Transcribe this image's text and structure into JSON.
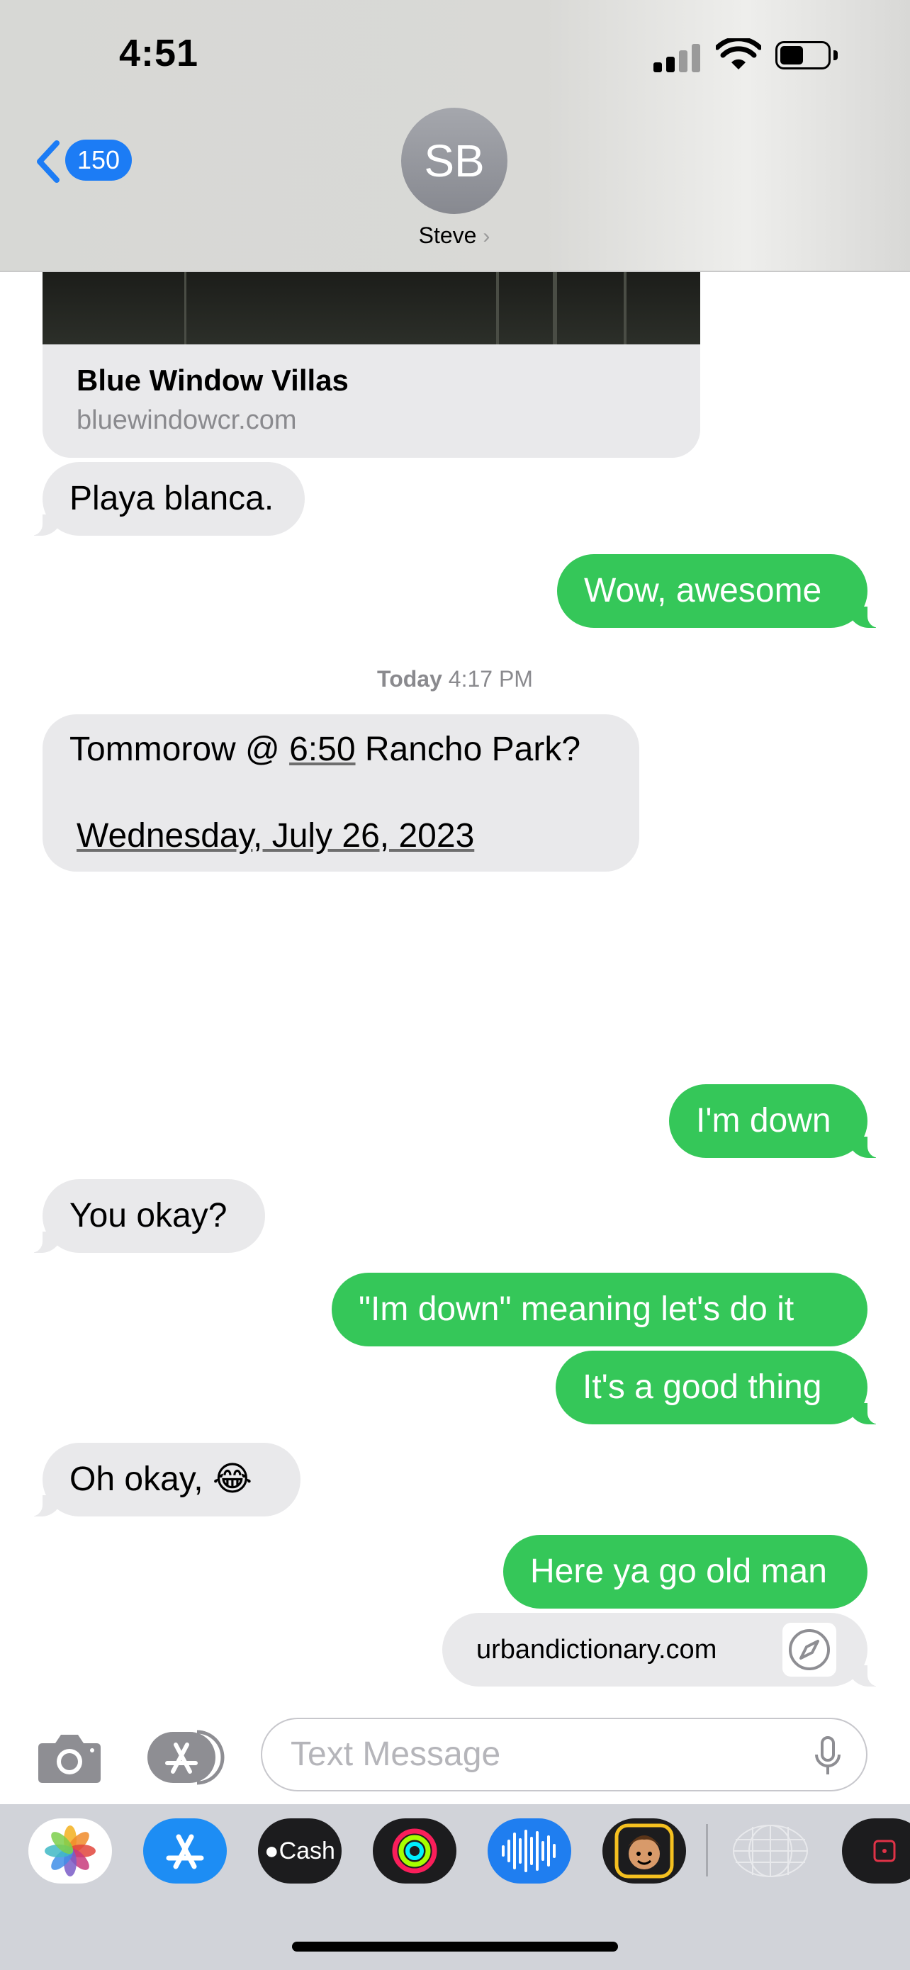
{
  "status_bar": {
    "time": "4:51"
  },
  "header": {
    "back_count": "150",
    "avatar_initials": "SB",
    "contact_name": "Steve"
  },
  "link_card": {
    "title": "Blue Window Villas",
    "domain": "bluewindowcr.com"
  },
  "messages": [
    {
      "id": "m1",
      "direction": "in",
      "text": "Playa blanca."
    },
    {
      "id": "m2",
      "direction": "out",
      "text": "Wow, awesome"
    },
    {
      "id": "m4",
      "direction": "out",
      "text": "I'm down"
    },
    {
      "id": "m5",
      "direction": "in",
      "text": "You okay?"
    },
    {
      "id": "m6",
      "direction": "out",
      "text": "\"Im down\" meaning let's do it"
    },
    {
      "id": "m7",
      "direction": "out",
      "text": "It's a good thing"
    },
    {
      "id": "m8",
      "direction": "in",
      "text": "Oh okay, 😂"
    },
    {
      "id": "m9",
      "direction": "out",
      "text": "Here ya go old man"
    }
  ],
  "timestamp": {
    "day": "Today",
    "time": "4:17 PM"
  },
  "big_message": {
    "before": "Tommorow @ ",
    "time_link": "6:50",
    "after": " Rancho Park?",
    "date_link": "Wednesday, July 26, 2023"
  },
  "url_preview": {
    "domain": "urbandictionary.com",
    "icon": "compass-icon"
  },
  "input_bar": {
    "placeholder": "Text Message"
  },
  "app_drawer": {
    "apps": [
      {
        "name": "Photos",
        "icon": "photos-icon"
      },
      {
        "name": "App Store",
        "icon": "app-store-icon"
      },
      {
        "name": "Apple Cash",
        "label": "Cash",
        "icon": "apple-cash-icon"
      },
      {
        "name": "Fitness",
        "icon": "activity-rings-icon"
      },
      {
        "name": "Audio Message",
        "icon": "waveform-icon"
      },
      {
        "name": "Memoji",
        "icon": "memoji-icon"
      },
      {
        "name": "Digital Touch",
        "icon": "digital-touch-icon"
      },
      {
        "name": "Record",
        "icon": "record-icon"
      }
    ]
  },
  "colors": {
    "imessage_blue": "#1c7cf5",
    "sms_green": "#35c759",
    "incoming_gray": "#e9e9eb"
  }
}
